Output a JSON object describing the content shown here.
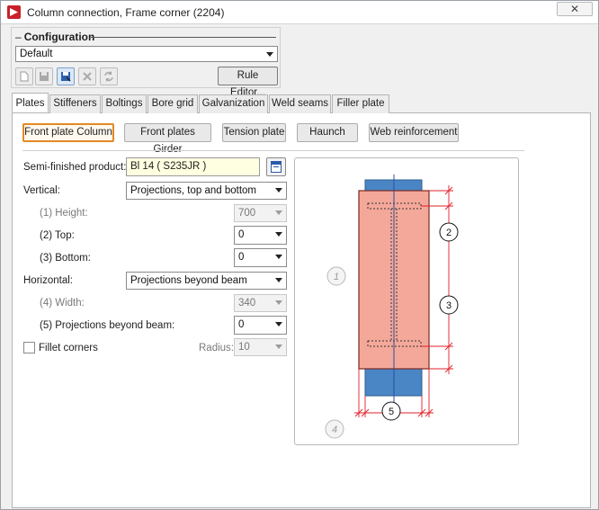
{
  "window": {
    "title": "Column connection, Frame corner (2204)",
    "close_label": "✕"
  },
  "configuration": {
    "legend": "Configuration",
    "selected": "Default",
    "rule_editor_label": "Rule Editor...",
    "toolbar_icons": [
      "new-icon",
      "save-icon",
      "save-as-icon",
      "delete-icon",
      "refresh-icon"
    ]
  },
  "tabs": [
    {
      "label": "Plates",
      "active": true
    },
    {
      "label": "Stiffeners",
      "active": false
    },
    {
      "label": "Boltings",
      "active": false
    },
    {
      "label": "Bore grid",
      "active": false
    },
    {
      "label": "Galvanization",
      "active": false
    },
    {
      "label": "Weld seams",
      "active": false
    },
    {
      "label": "Filler plate",
      "active": false
    }
  ],
  "plate_buttons": [
    {
      "label": "Front plate Column",
      "active": true
    },
    {
      "label": "Front plates Girder",
      "active": false
    },
    {
      "label": "Tension plate",
      "active": false
    },
    {
      "label": "Haunch",
      "active": false
    },
    {
      "label": "Web reinforcement",
      "active": false
    }
  ],
  "form": {
    "semi_finished_label": "Semi-finished product:",
    "semi_finished_value": "Bl 14  ( S235JR )",
    "vertical_label": "Vertical:",
    "vertical_value": "Projections, top and bottom",
    "height_label": "(1) Height:",
    "height_value": "700",
    "top_label": "(2) Top:",
    "top_value": "0",
    "bottom_label": "(3) Bottom:",
    "bottom_value": "0",
    "horizontal_label": "Horizontal:",
    "horizontal_value": "Projections beyond beam",
    "width_label": "(4) Width:",
    "width_value": "340",
    "proj_label": "(5) Projections beyond beam:",
    "proj_value": "0",
    "fillet_label": "Fillet corners",
    "fillet_checked": false,
    "radius_label": "Radius:",
    "radius_value": "10"
  },
  "diagram": {
    "labels": [
      "1",
      "2",
      "3",
      "4",
      "5"
    ],
    "plate_color": "#f4a89a",
    "steel_color": "#4a86c5",
    "dimension_color": "#e0202a"
  },
  "colors": {
    "accent": "#e28a25",
    "highlight_field": "#ffffe1"
  }
}
